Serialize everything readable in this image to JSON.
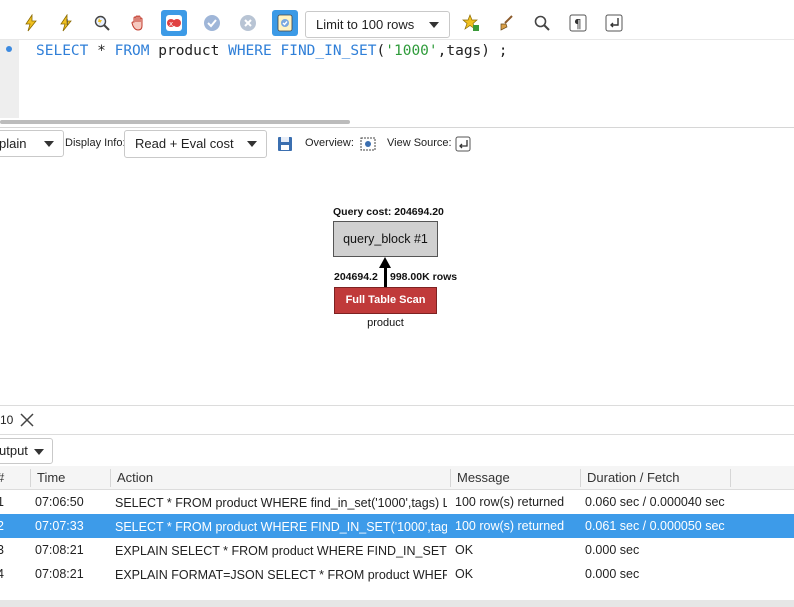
{
  "toolbar": {
    "icons": [
      "execute-icon",
      "execute-current-icon",
      "explain-icon",
      "stop-icon",
      "toggle-errors-icon",
      "commit-icon",
      "rollback-icon",
      "autocommit-icon",
      "beautify-icon",
      "find-icon",
      "invisible-chars-icon",
      "wrap-icon"
    ],
    "limit_label": "Limit to 100 rows"
  },
  "editor": {
    "sql": {
      "kw1": "SELECT",
      "star": " * ",
      "kw2": "FROM",
      "table": " product ",
      "kw3": "WHERE",
      "sp": " ",
      "func": "FIND_IN_SET",
      "open": "(",
      "literal": "'1000'",
      "rest": ",tags) ;"
    }
  },
  "explain_bar": {
    "mode": "plain",
    "display_info_label": "Display Info:",
    "display_info_value": "Read + Eval cost",
    "overview_label": "Overview:",
    "view_source_label": "View Source:"
  },
  "visual_explain": {
    "query_cost": "Query cost: 204694.20",
    "query_block": "query_block #1",
    "cost_left": "204694.2",
    "cost_right": "998.00K rows",
    "scan_label": "Full Table Scan",
    "table_name": "product"
  },
  "output": {
    "tab_label": "10",
    "selector_label": "utput",
    "columns": [
      "#",
      "Time",
      "Action",
      "Message",
      "Duration / Fetch"
    ],
    "rows": [
      {
        "num": "1",
        "time": "07:06:50",
        "action": "SELECT * FROM product WHERE find_in_set('1000',tags) L⋯",
        "message": "100 row(s) returned",
        "duration": "0.060 sec / 0.000040 sec"
      },
      {
        "num": "2",
        "time": "07:07:33",
        "action": "SELECT * FROM product WHERE FIND_IN_SET('1000',tags⋯",
        "message": "100 row(s) returned",
        "duration": "0.061 sec / 0.000050 sec"
      },
      {
        "num": "3",
        "time": "07:08:21",
        "action": "EXPLAIN SELECT * FROM product WHERE FIND_IN_SET('1⋯",
        "message": "OK",
        "duration": "0.000 sec"
      },
      {
        "num": "4",
        "time": "07:08:21",
        "action": "EXPLAIN FORMAT=JSON SELECT * FROM product WHERE ⋯",
        "message": "OK",
        "duration": "0.000 sec"
      }
    ],
    "selected_row": 1
  },
  "colors": {
    "accent": "#3d9be9",
    "keyword": "#2f7fd8",
    "string": "#2e9b3a",
    "scan_red": "#c03a3a"
  }
}
